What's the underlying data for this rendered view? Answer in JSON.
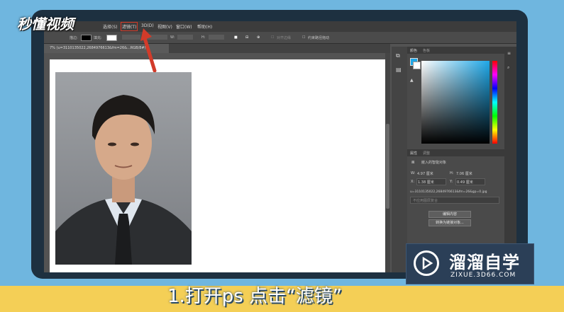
{
  "menubar": {
    "items": [
      "选择(S)",
      "滤镜(T)",
      "3D(D)",
      "视图(V)",
      "窗口(W)",
      "帮助(H)"
    ]
  },
  "options": {
    "stroke_label": "描边:",
    "fill_label": "填充:",
    "w_label": "W:",
    "h_label": "H:",
    "align_edges": "对齐边缘",
    "constrain_path": "约束路径拖动"
  },
  "document": {
    "tab_title": "7% (u=3110135022,2684976613&fm=26&...RGB/8#) *"
  },
  "panels": {
    "color_tab": "颜色",
    "swatches_tab": "色板",
    "properties_tab": "属性",
    "adjust_tab": "调整",
    "layer_type": "嵌入的智能对象",
    "w_label": "W:",
    "w_value": "4.97 厘米",
    "h_label": "H:",
    "h_value": "7.06 厘米",
    "x_label": "X:",
    "x_value": "1.38 厘米",
    "y_label": "Y:",
    "y_value": "0.49 厘米",
    "filename": "u=3110135022,2684976613&fm=26&gp=0.jpg",
    "layer_comp": "不应用图层复合",
    "edit_contents": "编辑内容",
    "convert_linked": "转换为链接对象..."
  },
  "watermark": {
    "logo_text": "秒懂视频",
    "caption": "1.打开ps  点击“滤镜”",
    "brand_name": "溜溜自学",
    "brand_url": "ZIXUE.3D66.COM"
  },
  "colors": {
    "accent_fg": "#1fa8e8",
    "annotation_red": "#d23b2a",
    "caption_band": "#f4cf56"
  }
}
